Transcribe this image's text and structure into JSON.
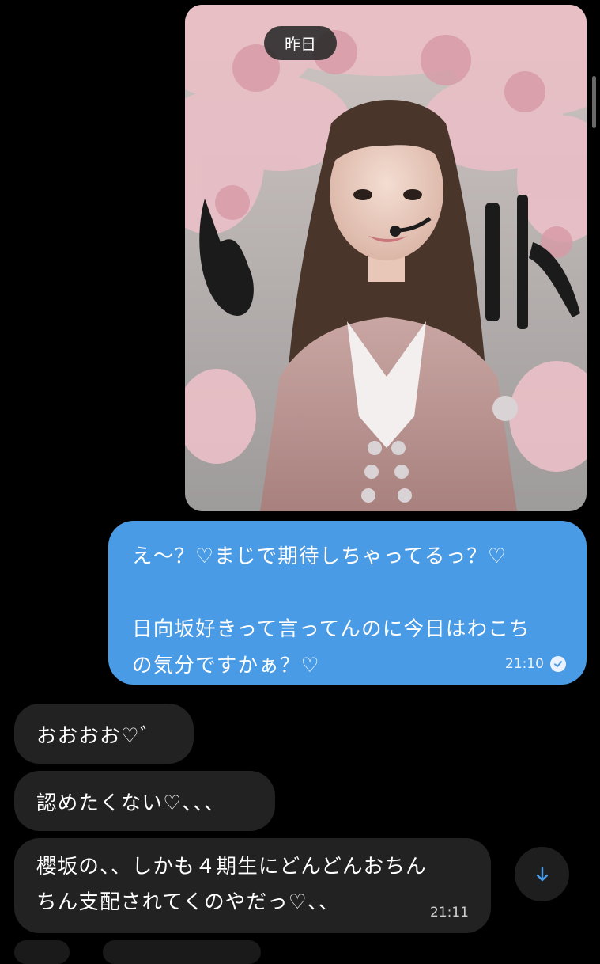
{
  "date_separator": "昨日",
  "outgoing_message": {
    "text": "え〜？♡まじで期待しちゃってるっ？♡\n\n日向坂好きって言ってんのに今日はわこち\nの気分ですかぁ？♡",
    "time": "21:10",
    "status_icon": "check-circle-icon"
  },
  "incoming_messages": [
    {
      "text": "おおおお♡゛"
    },
    {
      "text": "認めたくない♡、、、"
    },
    {
      "text": "櫻坂の、、しかも４期生にどんどんおちん\nちん支配されてくのやだっ♡、、",
      "time": "21:11"
    }
  ],
  "scroll_button_icon": "arrow-down-icon",
  "colors": {
    "background": "#000000",
    "outgoing_bubble": "#4a9be6",
    "incoming_bubble": "#222222",
    "date_pill": "#282828"
  }
}
